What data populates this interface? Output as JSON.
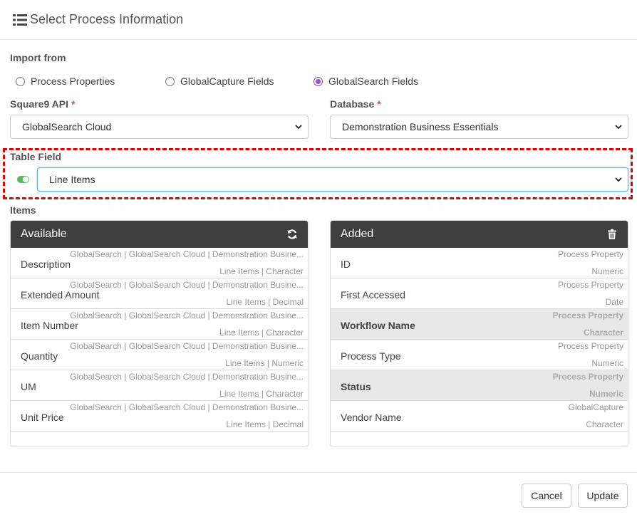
{
  "dialog": {
    "title": "Select Process Information"
  },
  "import_from": {
    "label": "Import from",
    "options": [
      {
        "label": "Process Properties",
        "checked": false
      },
      {
        "label": "GlobalCapture Fields",
        "checked": false
      },
      {
        "label": "GlobalSearch Fields",
        "checked": true
      }
    ]
  },
  "api": {
    "label": "Square9 API",
    "required": "*",
    "value": "GlobalSearch Cloud"
  },
  "database": {
    "label": "Database",
    "required": "*",
    "value": "Demonstration Business Essentials"
  },
  "table_field": {
    "label": "Table Field",
    "value": "Line Items",
    "enabled": true
  },
  "items_label": "Items",
  "available": {
    "title": "Available",
    "icon": "refresh-icon",
    "rows": [
      {
        "name": "Description",
        "source": "GlobalSearch | GlobalSearch Cloud | Demonstration Busine...",
        "type": "Line Items | Character"
      },
      {
        "name": "Extended Amount",
        "source": "GlobalSearch | GlobalSearch Cloud | Demonstration Busine...",
        "type": "Line Items | Decimal"
      },
      {
        "name": "Item Number",
        "source": "GlobalSearch | GlobalSearch Cloud | Demonstration Busine...",
        "type": "Line Items | Character"
      },
      {
        "name": "Quantity",
        "source": "GlobalSearch | GlobalSearch Cloud | Demonstration Busine...",
        "type": "Line Items | Numeric"
      },
      {
        "name": "UM",
        "source": "GlobalSearch | GlobalSearch Cloud | Demonstration Busine...",
        "type": "Line Items | Character"
      },
      {
        "name": "Unit Price",
        "source": "GlobalSearch | GlobalSearch Cloud | Demonstration Busine...",
        "type": "Line Items | Decimal"
      }
    ]
  },
  "added": {
    "title": "Added",
    "icon": "trash-icon",
    "rows": [
      {
        "name": "ID",
        "source": "Process Property",
        "type": "Numeric",
        "selected": false
      },
      {
        "name": "First Accessed",
        "source": "Process Property",
        "type": "Date",
        "selected": false
      },
      {
        "name": "Workflow Name",
        "source": "Process Property",
        "type": "Character",
        "selected": true
      },
      {
        "name": "Process Type",
        "source": "Process Property",
        "type": "Numeric",
        "selected": false
      },
      {
        "name": "Status",
        "source": "Process Property",
        "type": "Numeric",
        "selected": true
      },
      {
        "name": "Vendor Name",
        "source": "GlobalCapture",
        "type": "Character",
        "selected": false
      }
    ]
  },
  "buttons": {
    "cancel": "Cancel",
    "update": "Update"
  },
  "colors": {
    "accent_radio": "#a148d0",
    "highlight_border": "#e00000",
    "panel_header": "#3f3f3f",
    "toggle_on": "#5cb85c"
  }
}
